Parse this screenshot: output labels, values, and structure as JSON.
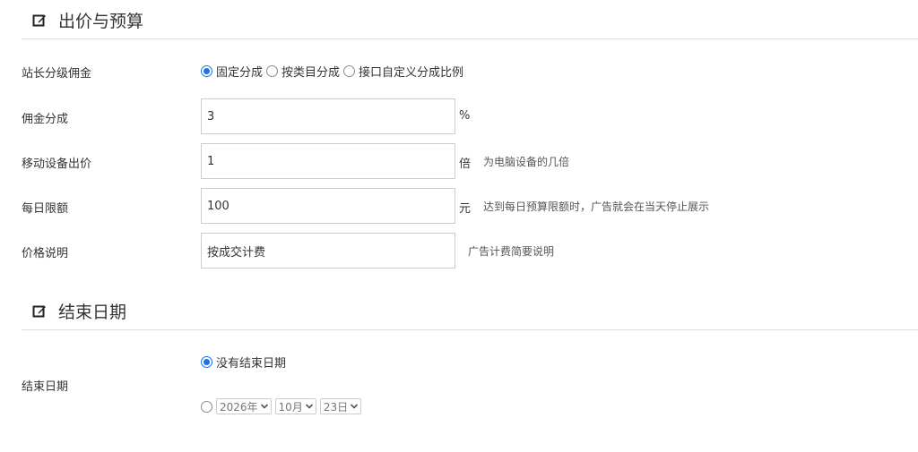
{
  "sections": {
    "bid": {
      "title": "出价与预算",
      "icon": "edit-icon"
    },
    "end": {
      "title": "结束日期",
      "icon": "edit-icon"
    }
  },
  "commission_type": {
    "label": "站长分级佣金",
    "options": [
      {
        "label": "固定分成",
        "checked": true
      },
      {
        "label": "按类目分成",
        "checked": false
      },
      {
        "label": "接口自定义分成比例",
        "checked": false
      }
    ]
  },
  "commission_rate": {
    "label": "佣金分成",
    "value": "3",
    "unit": "%"
  },
  "mobile_bid": {
    "label": "移动设备出价",
    "value": "1",
    "unit": "倍",
    "help": "为电脑设备的几倍"
  },
  "daily_limit": {
    "label": "每日限额",
    "value": "100",
    "unit": "元",
    "help": "达到每日预算限额时，广告就会在当天停止展示"
  },
  "price_desc": {
    "label": "价格说明",
    "value": "按成交计费",
    "help": "广告计费简要说明"
  },
  "end_date": {
    "label": "结束日期",
    "no_end": {
      "label": "没有结束日期",
      "checked": true
    },
    "custom": {
      "checked": false,
      "year": "2026年",
      "month": "10月",
      "day": "23日"
    }
  },
  "colors": {
    "accent": "#1a73e8",
    "border": "#cccccc",
    "divider": "#dddddd"
  }
}
